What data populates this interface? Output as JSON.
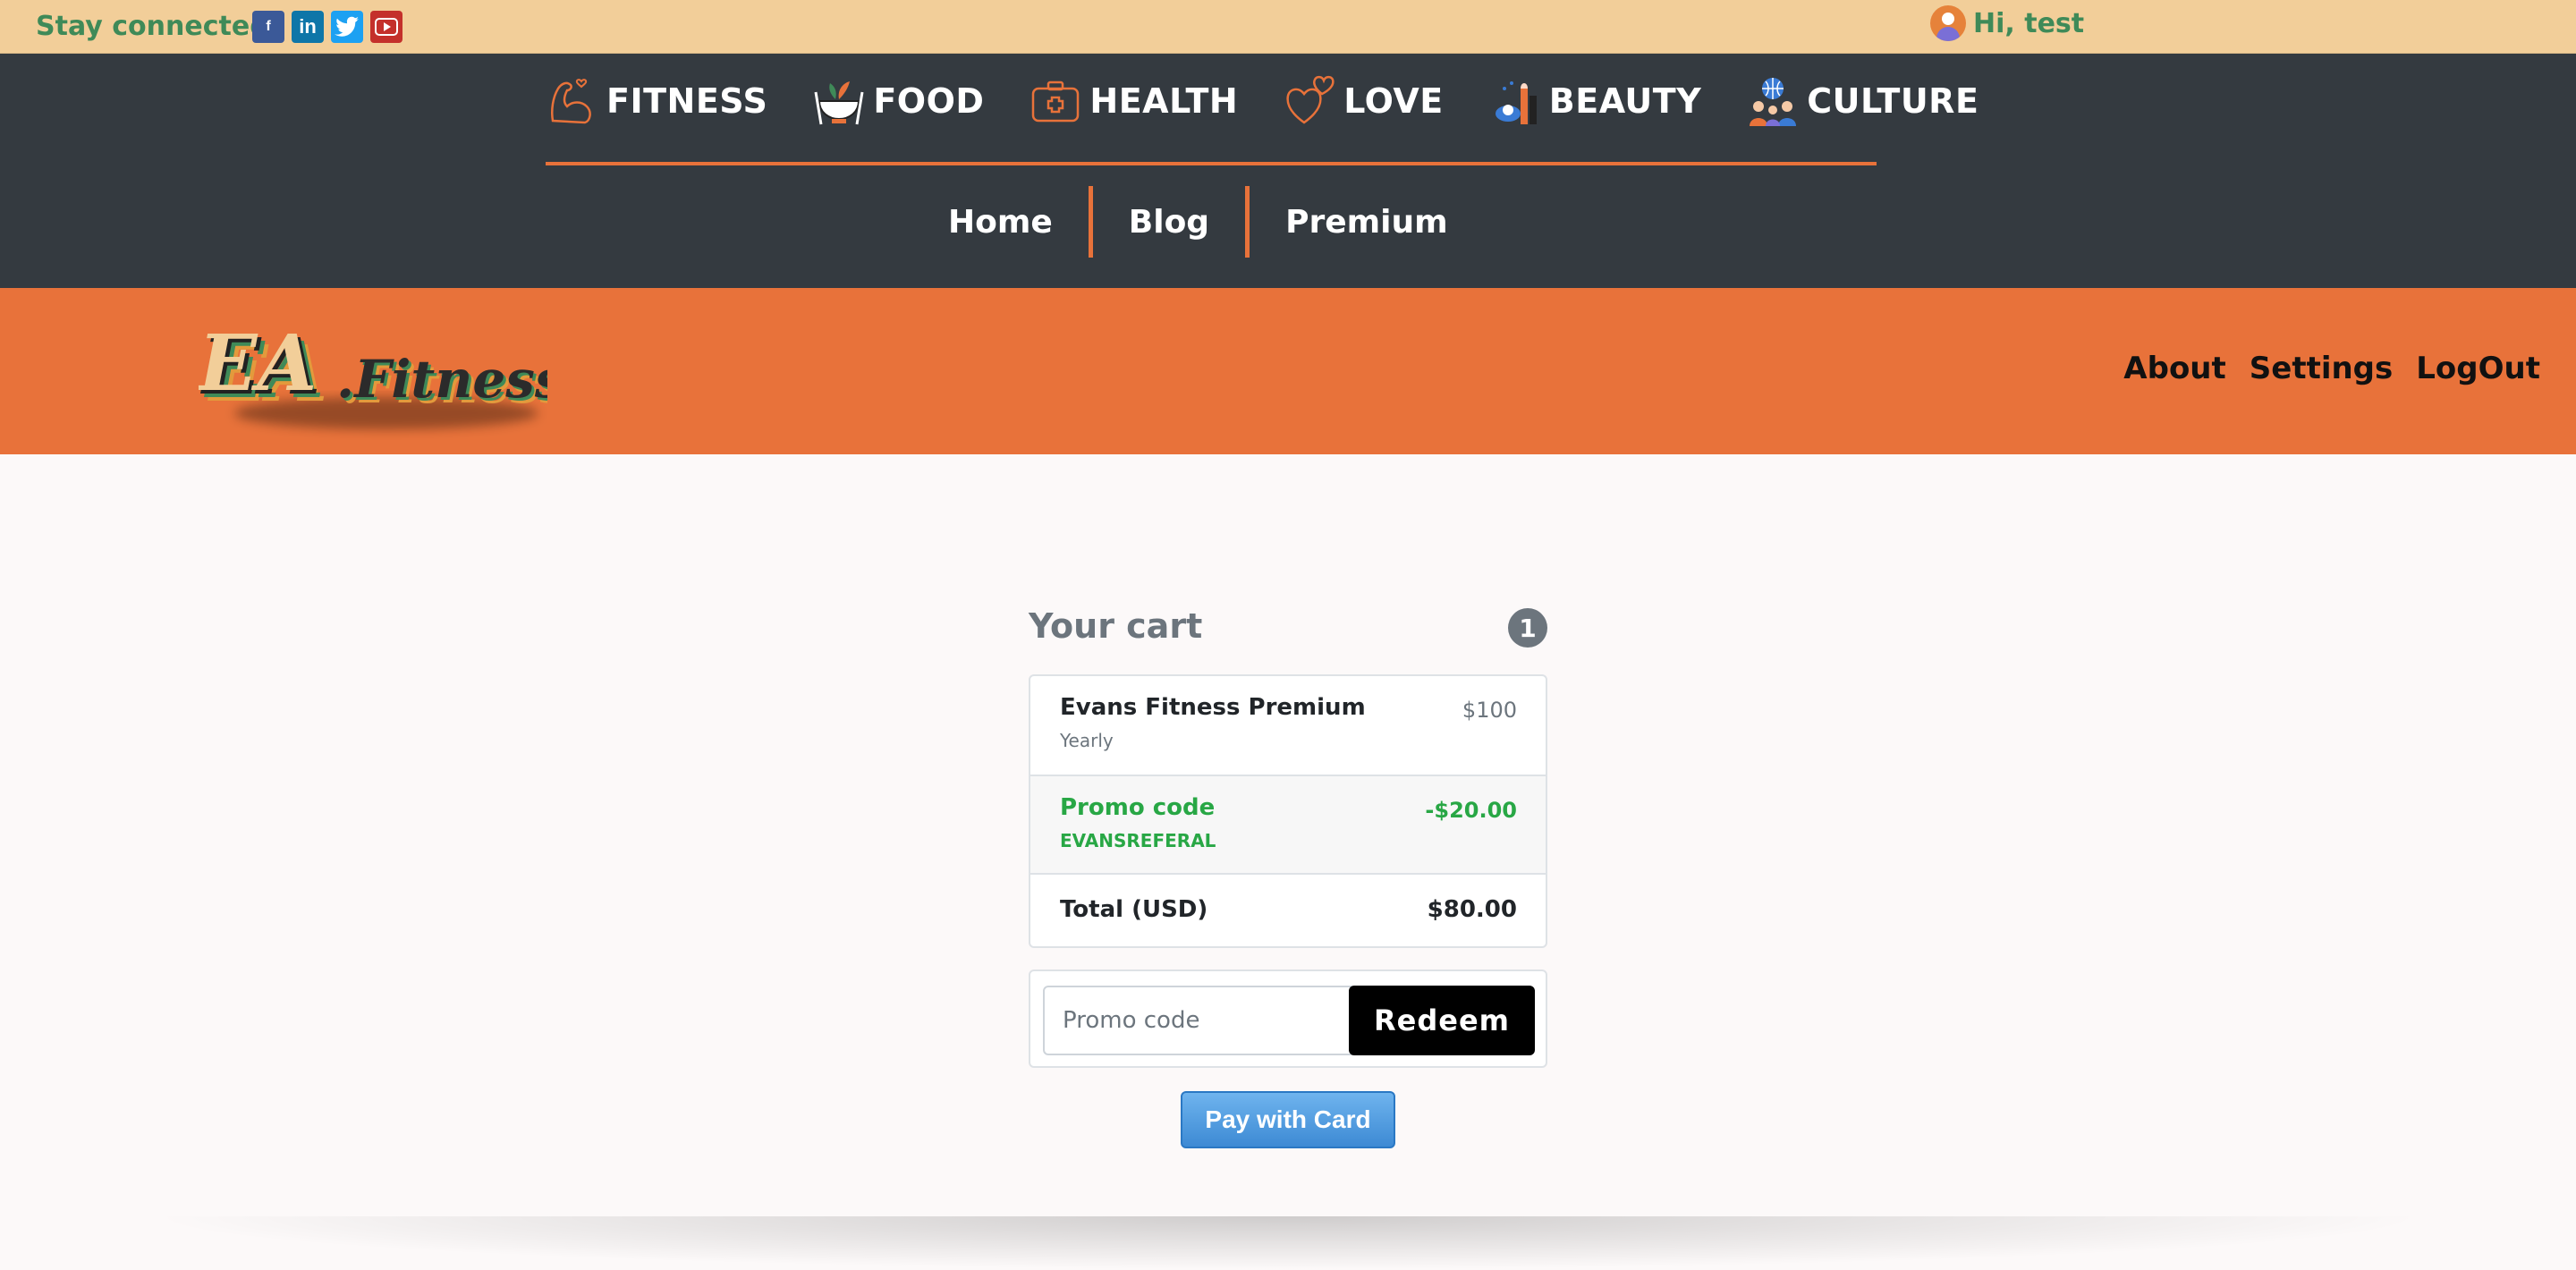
{
  "topbar": {
    "stay_connected": "Stay connected",
    "social": [
      {
        "name": "facebook",
        "glyph": "f",
        "color": "#3b5998"
      },
      {
        "name": "linkedin",
        "glyph": "in",
        "color": "#0e76a8"
      },
      {
        "name": "twitter",
        "glyph": "t",
        "color": "#1da1f2"
      },
      {
        "name": "youtube",
        "glyph": "▶",
        "color": "#c4302b"
      }
    ],
    "greeting": "Hi, test"
  },
  "categories": [
    {
      "label": "FITNESS",
      "icon": "muscle-arm-icon"
    },
    {
      "label": "FOOD",
      "icon": "food-bowl-icon"
    },
    {
      "label": "HEALTH",
      "icon": "first-aid-kit-icon"
    },
    {
      "label": "LOVE",
      "icon": "hearts-icon"
    },
    {
      "label": "BEAUTY",
      "icon": "cosmetics-icon"
    },
    {
      "label": "CULTURE",
      "icon": "people-globe-icon"
    }
  ],
  "subnav": [
    "Home",
    "Blog",
    "Premium"
  ],
  "brand": {
    "right_links": [
      "About",
      "Settings",
      "LogOut"
    ]
  },
  "cart": {
    "title": "Your cart",
    "count": "1",
    "item": {
      "name": "Evans Fitness Premium",
      "sub": "Yearly",
      "price": "$100"
    },
    "promo": {
      "name": "Promo code",
      "code": "EVANSREFERAL",
      "amount": "-$20.00"
    },
    "total": {
      "label": "Total (USD)",
      "amount": "$80.00"
    }
  },
  "promo_form": {
    "placeholder": "Promo code",
    "value": "",
    "button": "Redeem"
  },
  "pay_button": "Pay with Card",
  "colors": {
    "topbar": "#f2ce99",
    "dark_nav": "#343a40",
    "accent": "#e8723a",
    "green": "#28a745"
  }
}
